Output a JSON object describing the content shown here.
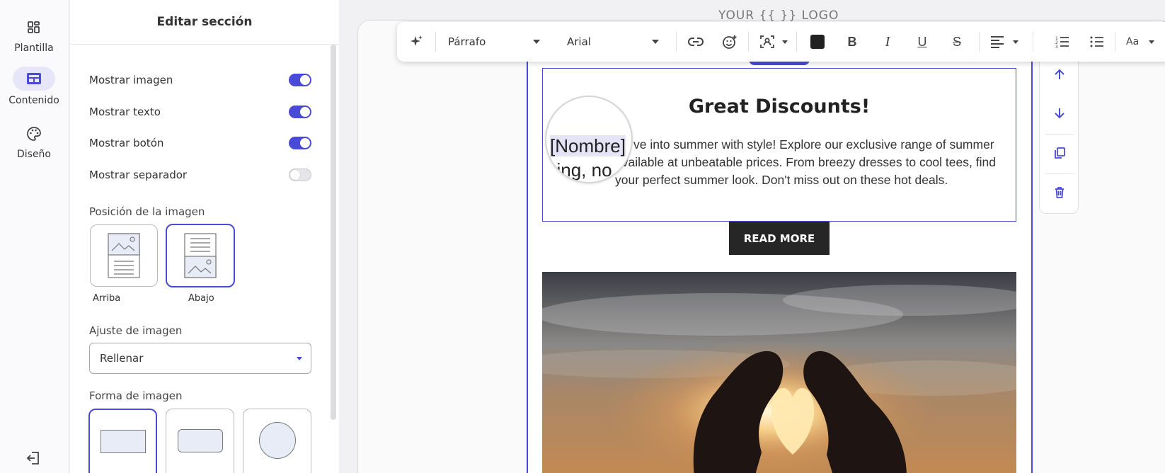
{
  "rail": {
    "items": [
      {
        "label": "Plantilla",
        "icon": "grid-icon"
      },
      {
        "label": "Contenido",
        "icon": "layout-icon"
      },
      {
        "label": "Diseño",
        "icon": "palette-icon"
      }
    ],
    "logout_icon": "logout-icon"
  },
  "panel": {
    "title": "Editar sección",
    "toggles": [
      {
        "label": "Mostrar imagen",
        "on": true
      },
      {
        "label": "Mostrar texto",
        "on": true
      },
      {
        "label": "Mostrar botón",
        "on": true
      },
      {
        "label": "Mostrar separador",
        "on": false
      }
    ],
    "image_position": {
      "label": "Posición de la imagen",
      "options": [
        {
          "caption": "Arriba",
          "selected": false
        },
        {
          "caption": "Abajo",
          "selected": true
        }
      ]
    },
    "image_fit": {
      "label": "Ajuste de imagen",
      "value": "Rellenar"
    },
    "image_shape": {
      "label": "Forma de imagen",
      "options": [
        {
          "shape": "rectangle",
          "selected": true
        },
        {
          "shape": "rounded",
          "selected": false
        },
        {
          "shape": "circle",
          "selected": false
        }
      ]
    }
  },
  "toolbar": {
    "paragraph_style": "Párrafo",
    "font_family": "Arial",
    "text_color": "#222222",
    "size_label": "Aa"
  },
  "canvas": {
    "logo_peek": "YOUR  {{ }}  LOGO",
    "title": "Great Discounts!",
    "body_line1": "ve into summer with style! Explore our exclusive range of summer",
    "body_line2": "available at unbeatable prices. From breezy dresses to cool tees, find",
    "body_line3": "your perfect summer look. Don't miss out on these hot deals.",
    "magnifier_line1": "[Nombre]",
    "magnifier_line2": "hing, no",
    "button_label": "READ MORE"
  },
  "colors": {
    "accent": "#4a4ad8",
    "button": "#262626"
  }
}
